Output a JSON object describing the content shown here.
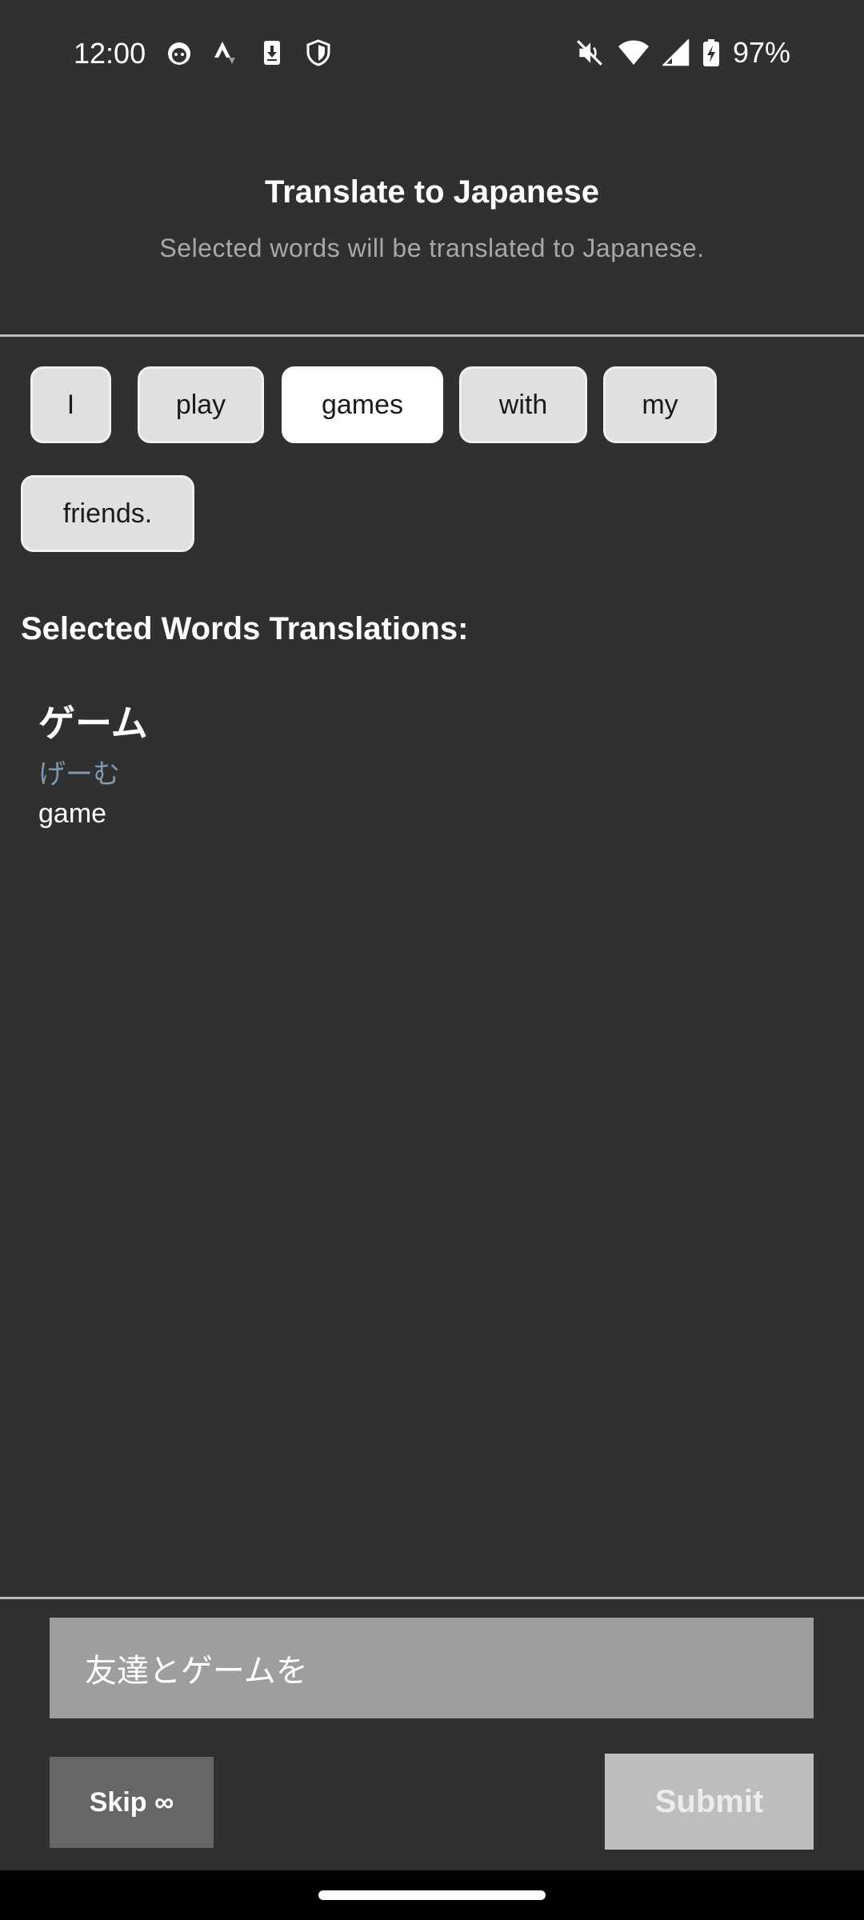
{
  "status_bar": {
    "time": "12:00",
    "battery": "97%",
    "icons_left": [
      "cat-face-icon",
      "strava-icon",
      "download-phone-icon",
      "shield-icon"
    ],
    "icons_right": [
      "mute-icon",
      "wifi-icon",
      "signal-icon",
      "battery-charging-icon"
    ]
  },
  "header": {
    "title": "Translate to Japanese",
    "subtitle": "Selected words will be translated to Japanese."
  },
  "words": [
    {
      "label": "I",
      "selected": false
    },
    {
      "label": "play",
      "selected": false
    },
    {
      "label": "games",
      "selected": true
    },
    {
      "label": "with",
      "selected": false
    },
    {
      "label": "my",
      "selected": false
    },
    {
      "label": "friends.",
      "selected": false
    }
  ],
  "translations": {
    "heading": "Selected Words Translations:",
    "items": [
      {
        "word": "ゲーム",
        "reading": "げーむ",
        "meaning": "game"
      }
    ]
  },
  "answer": {
    "value": "友達とゲームを"
  },
  "actions": {
    "skip_label": "Skip ∞",
    "submit_label": "Submit"
  },
  "colors": {
    "background": "#303030",
    "chip": "#e0e0e0",
    "chip_selected": "#ffffff",
    "reading": "#7f98ad",
    "input_bg": "#9e9e9e",
    "skip_bg": "#666666",
    "submit_bg": "#bdbdbd"
  }
}
